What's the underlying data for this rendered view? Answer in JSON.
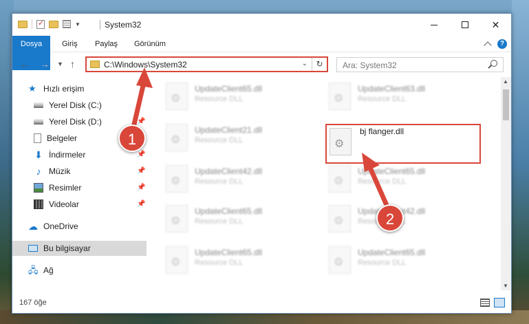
{
  "window": {
    "title": "System32"
  },
  "ribbon": {
    "tabs": [
      "Dosya",
      "Giriş",
      "Paylaş",
      "Görünüm"
    ]
  },
  "address": {
    "path": "C:\\Windows\\System32",
    "search_placeholder": "Ara: System32"
  },
  "sidebar": {
    "items": [
      {
        "label": "Hızlı erişim",
        "icon": "star-icon",
        "pinned": false
      },
      {
        "label": "Yerel Disk (C:)",
        "icon": "drive-icon",
        "pinned": false
      },
      {
        "label": "Yerel Disk (D:)",
        "icon": "drive-icon",
        "pinned": true
      },
      {
        "label": "Belgeler",
        "icon": "document-icon",
        "pinned": true
      },
      {
        "label": "İndirmeler",
        "icon": "download-icon",
        "pinned": true
      },
      {
        "label": "Müzik",
        "icon": "music-icon",
        "pinned": true
      },
      {
        "label": "Resimler",
        "icon": "pictures-icon",
        "pinned": true
      },
      {
        "label": "Videolar",
        "icon": "videos-icon",
        "pinned": true
      },
      {
        "label": "OneDrive",
        "icon": "cloud-icon",
        "pinned": false
      },
      {
        "label": "Bu bilgisayar",
        "icon": "computer-icon",
        "pinned": false
      },
      {
        "label": "Ağ",
        "icon": "network-icon",
        "pinned": false
      }
    ]
  },
  "files": [
    {
      "name": "UpdateClient65.dll",
      "type": "Resource DLL"
    },
    {
      "name": "UpdateClient63.dll",
      "type": "Resource DLL"
    },
    {
      "name": "UpdateClient21.dll",
      "type": "Resource DLL"
    },
    {
      "name": "bj flanger.dll",
      "type": ""
    },
    {
      "name": "UpdateClient42.dll",
      "type": "Resource DLL"
    },
    {
      "name": "UpdateClient65.dll",
      "type": "Resource DLL"
    },
    {
      "name": "UpdateClient65.dll",
      "type": "Resource DLL"
    },
    {
      "name": "UpdateClient42.dll",
      "type": "Resource DLL"
    },
    {
      "name": "UpdateClient65.dll",
      "type": "Resource DLL"
    },
    {
      "name": "UpdateClient65.dll",
      "type": "Resource DLL"
    }
  ],
  "status": {
    "count": "167 öğe"
  },
  "annotations": {
    "step1": "1",
    "step2": "2"
  },
  "colors": {
    "accent": "#1979ca",
    "highlight": "#d9473a"
  }
}
